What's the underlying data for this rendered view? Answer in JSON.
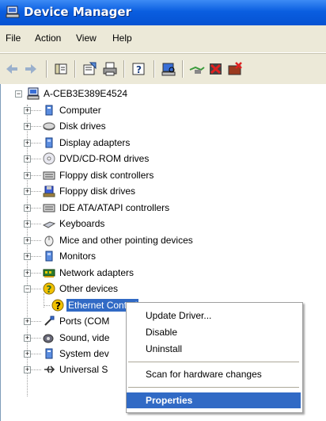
{
  "window": {
    "title": "Device Manager"
  },
  "menu": {
    "items": [
      "File",
      "Action",
      "View",
      "Help"
    ]
  },
  "toolbar": {
    "buttons": [
      "back-icon",
      "forward-icon",
      "show-hide-tree-icon",
      "properties-icon",
      "print-icon",
      "help-icon",
      "scan-icon",
      "update-driver-icon",
      "disable-icon",
      "uninstall-icon"
    ]
  },
  "tree": {
    "root": "A-CEB3E389E4524",
    "items": [
      "Computer",
      "Disk drives",
      "Display adapters",
      "DVD/CD-ROM drives",
      "Floppy disk controllers",
      "Floppy disk drives",
      "IDE ATA/ATAPI controllers",
      "Keyboards",
      "Mice and other pointing devices",
      "Monitors",
      "Network adapters",
      "Other devices",
      "Ethernet Controller",
      "Ports (COM & LPT)",
      "Sound, video and game controllers",
      "System devices",
      "Universal Serial Bus controllers"
    ],
    "visible_labels": [
      "Computer",
      "Disk drives",
      "Display adapters",
      "DVD/CD-ROM drives",
      "Floppy disk controllers",
      "Floppy disk drives",
      "IDE ATA/ATAPI controllers",
      "Keyboards",
      "Mice and other pointing devices",
      "Monitors",
      "Network adapters",
      "Other devices",
      "Ethernet Control",
      "Ports (COM",
      "Sound, vide",
      "System dev",
      "Universal S"
    ]
  },
  "context_menu": {
    "update_driver": "Update Driver...",
    "disable": "Disable",
    "uninstall": "Uninstall",
    "scan": "Scan for hardware changes",
    "properties": "Properties"
  },
  "colors": {
    "titlebar": "#0552d2",
    "selection": "#316ac5",
    "chrome": "#ece9d8"
  }
}
